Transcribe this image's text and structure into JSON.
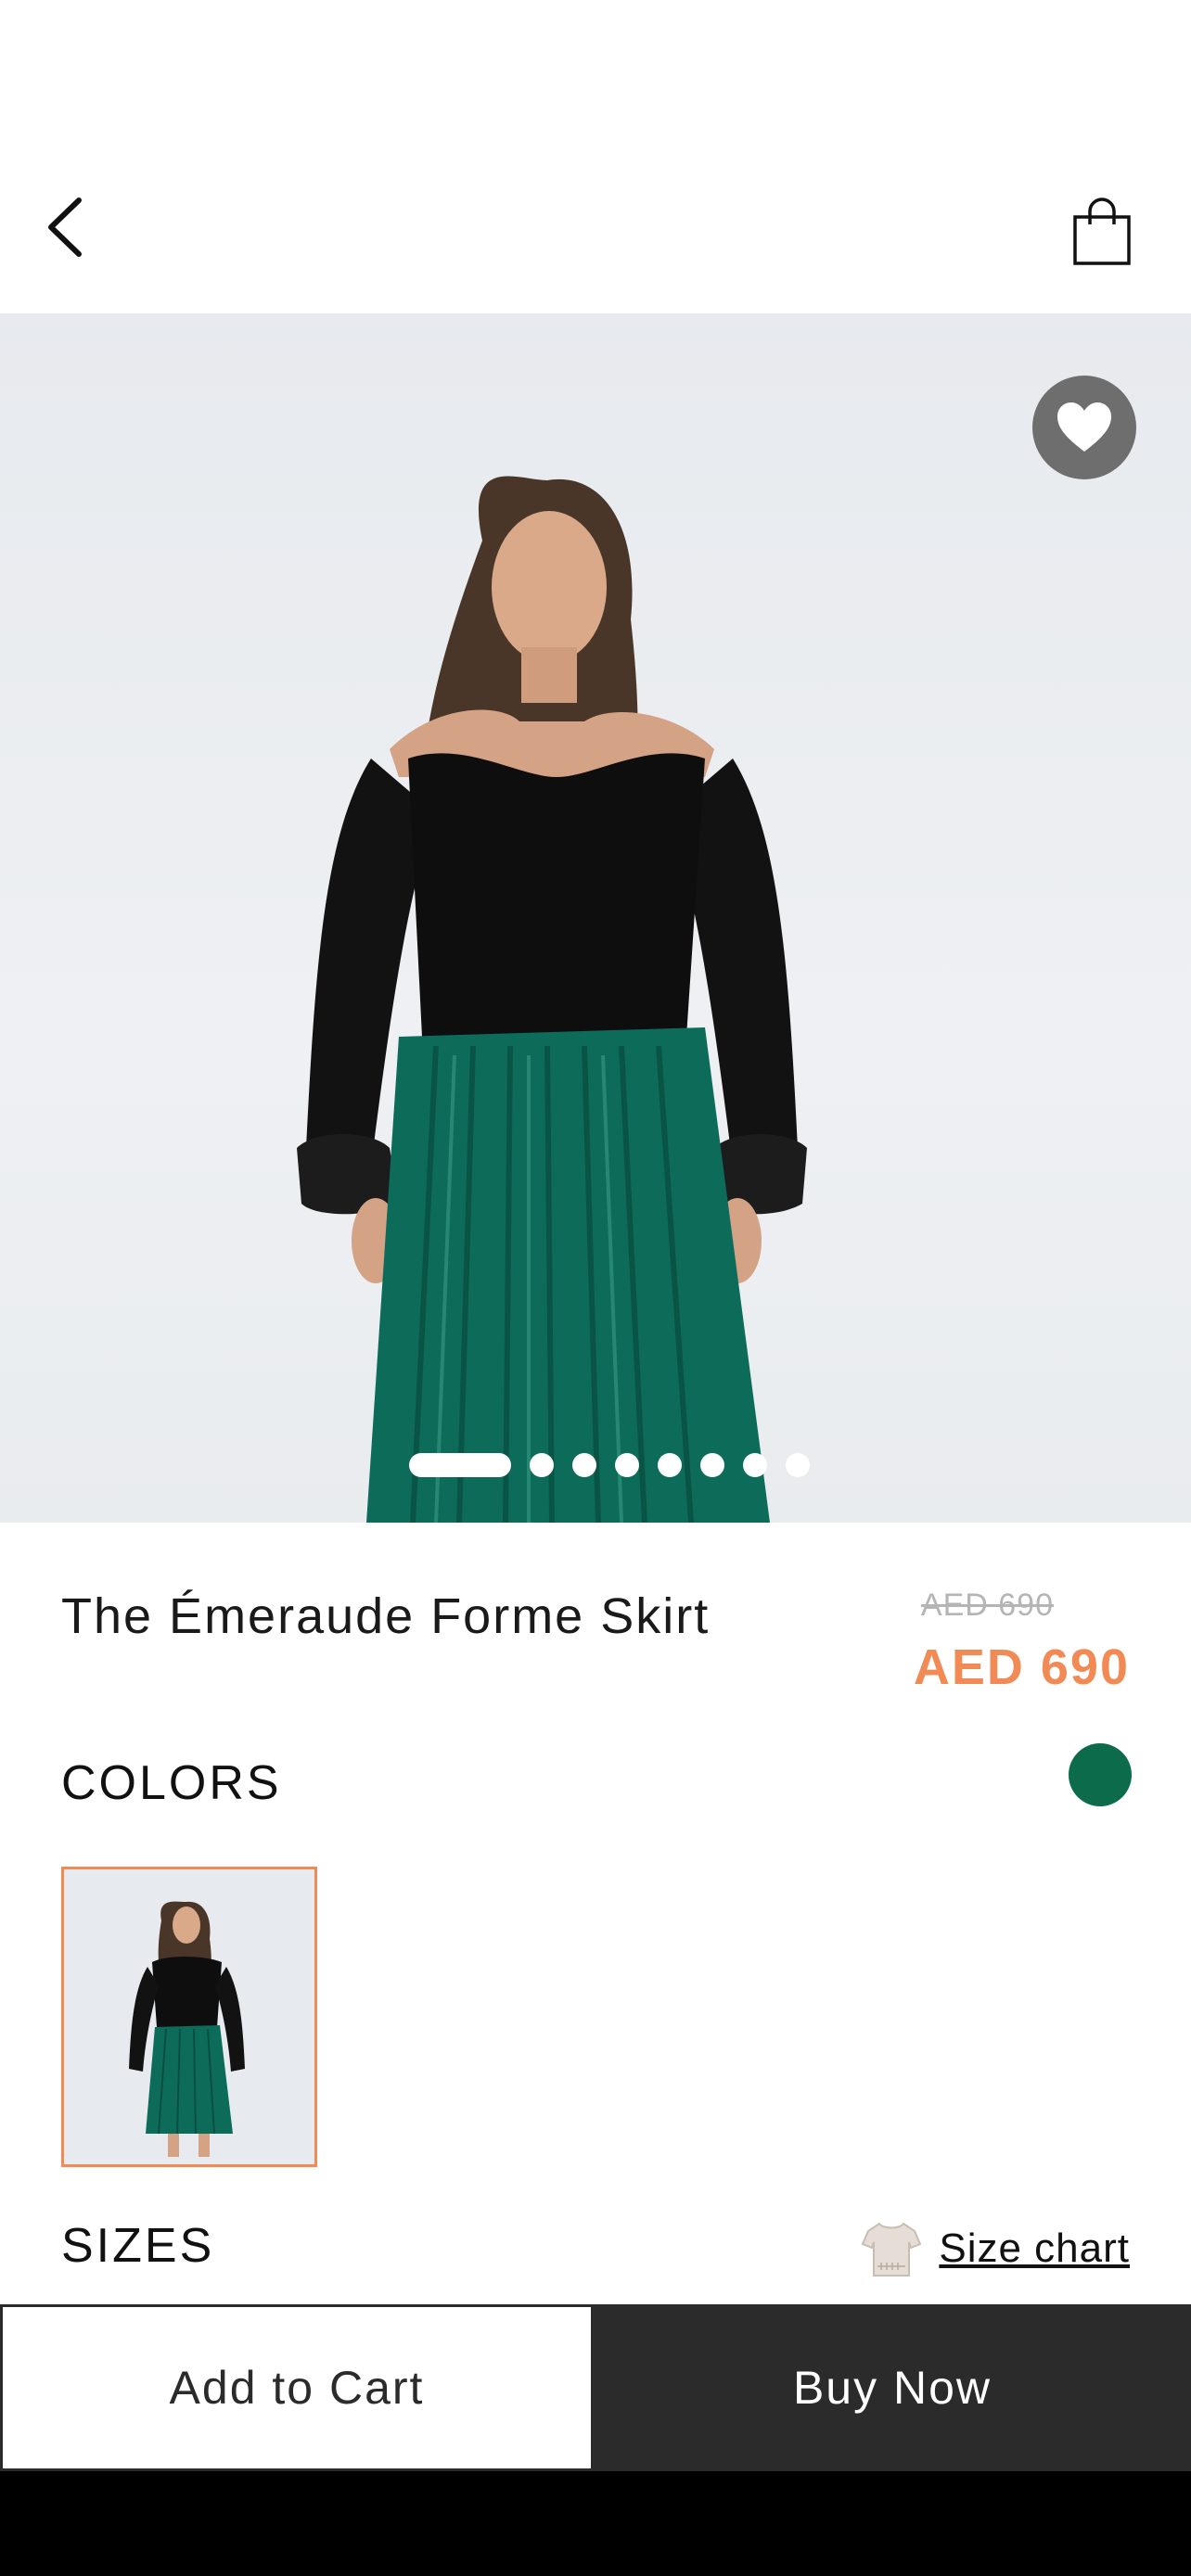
{
  "header": {
    "back_icon": "chevron-left-icon",
    "bag_icon": "shopping-bag-icon"
  },
  "gallery": {
    "favorite_icon": "heart-icon",
    "image_count": 8,
    "active_index": 0
  },
  "product": {
    "title": "The Émeraude Forme Skirt",
    "old_price": "AED 690",
    "price": "AED 690",
    "price_color": "#f28a55"
  },
  "colors": {
    "label": "COLORS",
    "selected_color": "#0b6b4a"
  },
  "sizes": {
    "label": "SIZES",
    "size_chart_label": "Size chart",
    "size_chart_icon": "tshirt-icon"
  },
  "actions": {
    "add_to_cart": "Add to Cart",
    "buy_now": "Buy Now"
  }
}
